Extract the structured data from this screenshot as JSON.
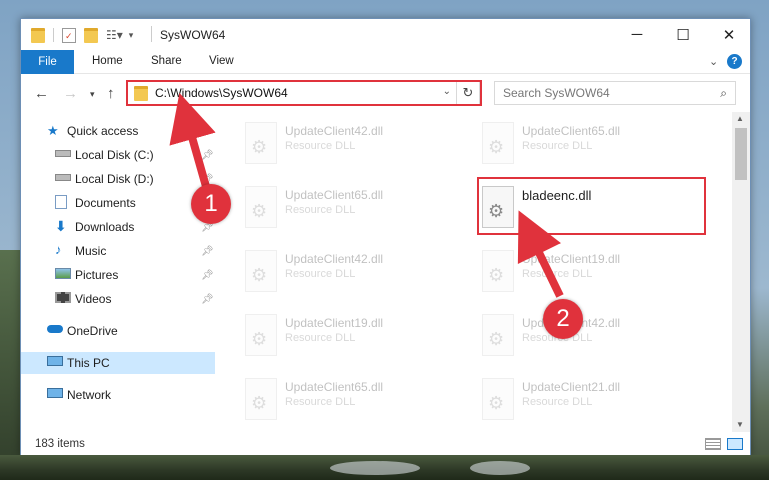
{
  "window": {
    "title": "SysWOW64"
  },
  "ribbon": {
    "tabs": [
      "File",
      "Home",
      "Share",
      "View"
    ]
  },
  "address_bar": {
    "path": "C:\\Windows\\SysWOW64"
  },
  "search": {
    "placeholder": "Search SysWOW64"
  },
  "nav_pane": {
    "items": [
      {
        "label": "Quick access",
        "icon": "star-icon"
      },
      {
        "label": "Local Disk (C:)",
        "icon": "drive-icon"
      },
      {
        "label": "Local Disk (D:)",
        "icon": "drive-icon"
      },
      {
        "label": "Documents",
        "icon": "documents-icon"
      },
      {
        "label": "Downloads",
        "icon": "download-icon"
      },
      {
        "label": "Music",
        "icon": "music-icon"
      },
      {
        "label": "Pictures",
        "icon": "pictures-icon"
      },
      {
        "label": "Videos",
        "icon": "videos-icon"
      },
      {
        "label": "OneDrive",
        "icon": "cloud-icon"
      },
      {
        "label": "This PC",
        "icon": "computer-icon"
      },
      {
        "label": "Network",
        "icon": "network-icon"
      }
    ]
  },
  "files": [
    {
      "name": "UpdateClient42.dll",
      "type": "Resource DLL"
    },
    {
      "name": "UpdateClient65.dll",
      "type": "Resource DLL"
    },
    {
      "name": "UpdateClient65.dll",
      "type": "Resource DLL"
    },
    {
      "name": "bladeenc.dll",
      "type": ""
    },
    {
      "name": "UpdateClient42.dll",
      "type": "Resource DLL"
    },
    {
      "name": "UpdateClient19.dll",
      "type": "Resource DLL"
    },
    {
      "name": "UpdateClient19.dll",
      "type": "Resource DLL"
    },
    {
      "name": "UpdateClient42.dll",
      "type": "Resource DLL"
    },
    {
      "name": "UpdateClient65.dll",
      "type": "Resource DLL"
    },
    {
      "name": "UpdateClient21.dll",
      "type": "Resource DLL"
    }
  ],
  "status": {
    "item_count": "183 items"
  },
  "annotations": {
    "step1": "1",
    "step2": "2",
    "color": "#e0323c"
  },
  "colors": {
    "accent": "#1979ca",
    "selection": "#cce8ff"
  }
}
